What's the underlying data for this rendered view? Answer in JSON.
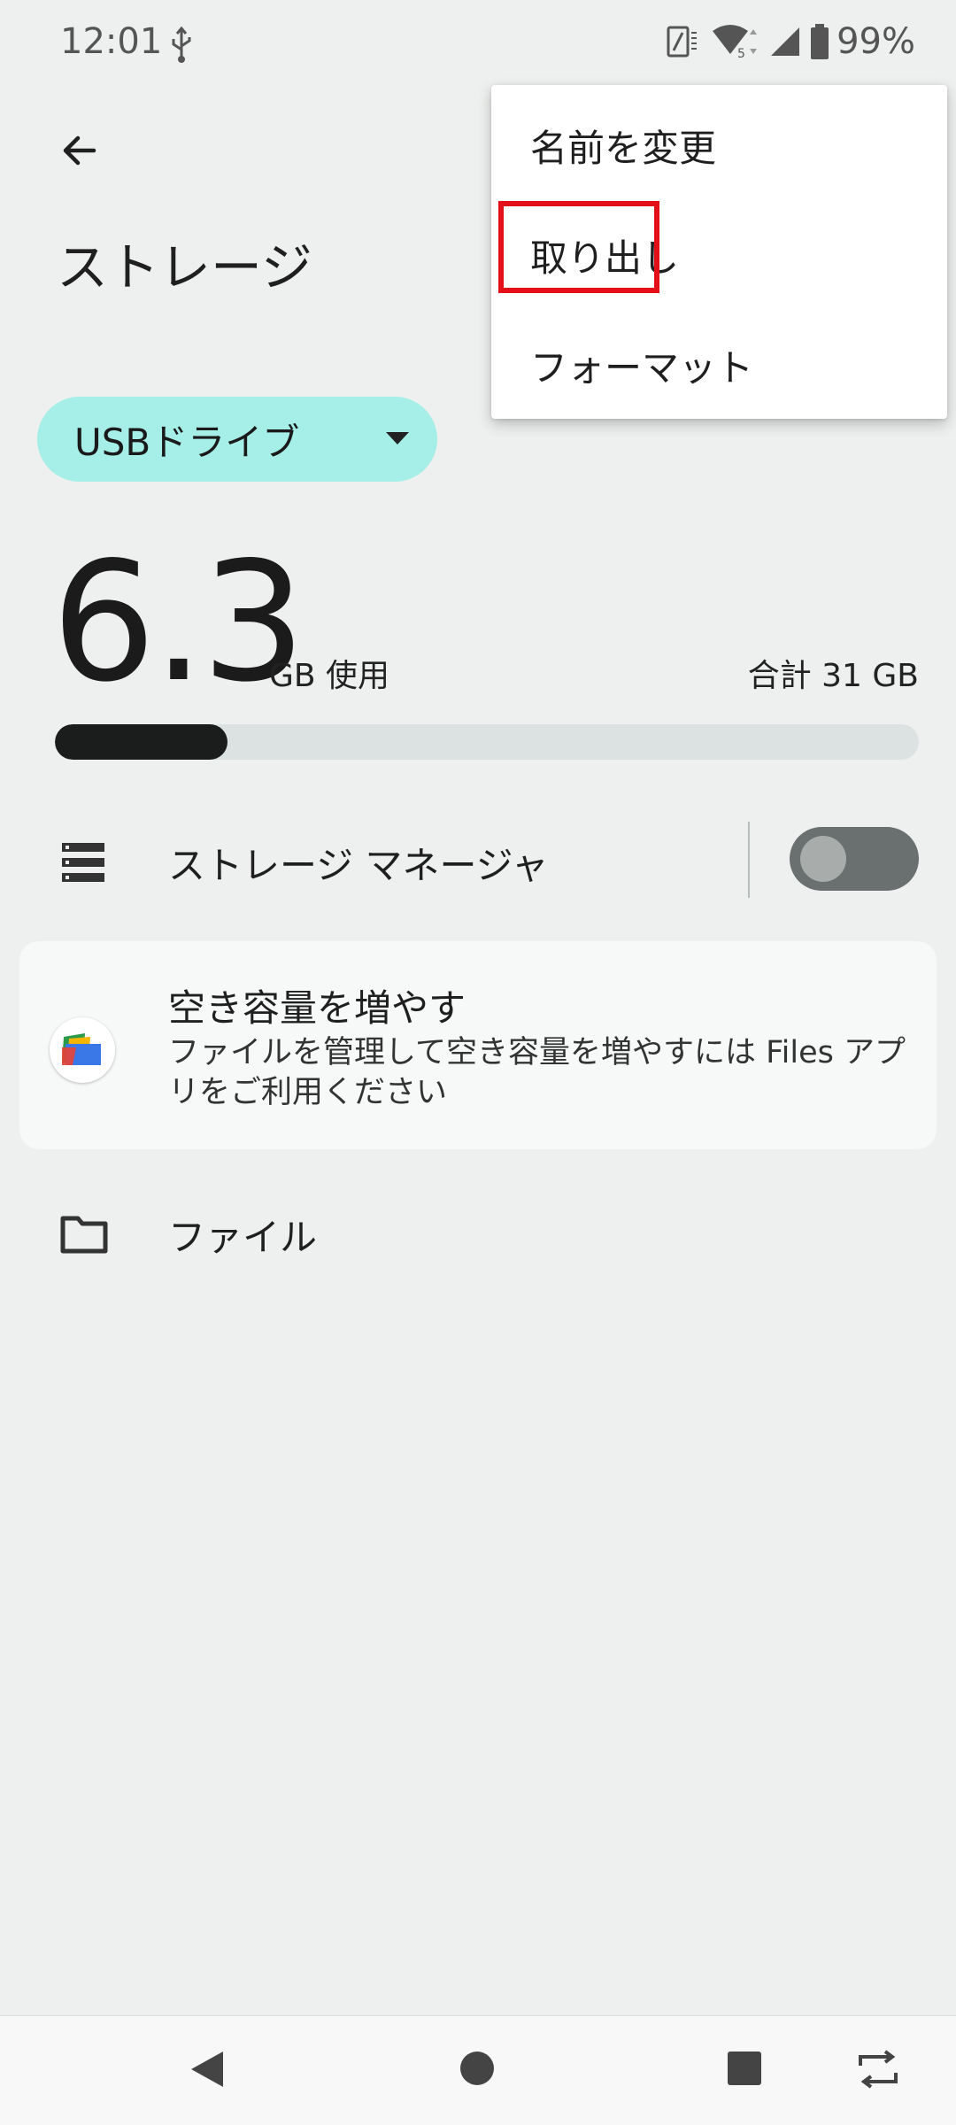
{
  "status_bar": {
    "time": "12:01",
    "battery": "99%",
    "icons": [
      "usb-icon",
      "vibrate-icon",
      "wifi-icon",
      "signal-icon",
      "battery-icon"
    ]
  },
  "header": {
    "back_icon": "arrow-back-icon",
    "title": "ストレージ"
  },
  "storage_selector": {
    "selected": "USBドライブ",
    "color": "#a6efe8"
  },
  "usage": {
    "used_value": "6.3",
    "used_unit": "GB 使用",
    "total": "合計 31 GB",
    "used_fraction": 0.2
  },
  "storage_manager": {
    "label": "ストレージ マネージャ",
    "enabled": false
  },
  "free_up_card": {
    "title": "空き容量を増やす",
    "description": "ファイルを管理して空き容量を増やすには Files アプリをご利用ください"
  },
  "files_row": {
    "label": "ファイル"
  },
  "overflow_menu": {
    "items": [
      {
        "label": "名前を変更"
      },
      {
        "label": "取り出し",
        "highlighted": true
      },
      {
        "label": "フォーマット"
      }
    ],
    "highlight_color": "#e3101a"
  },
  "nav_bar": {
    "icons": [
      "nav-back-icon",
      "nav-home-icon",
      "nav-recents-icon",
      "rotate-icon"
    ]
  }
}
